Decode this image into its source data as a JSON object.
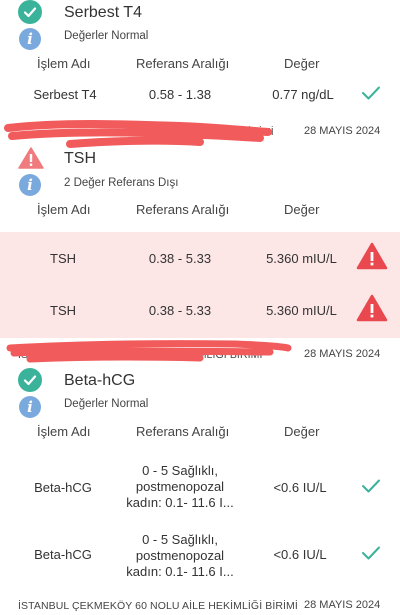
{
  "sections": [
    {
      "title": "Serbest T4",
      "status": "Değerler Normal",
      "headers": {
        "name": "İşlem Adı",
        "range": "Referans Aralığı",
        "value": "Değer"
      },
      "rows": [
        {
          "name": "Serbest T4",
          "range": "0.58 - 1.38",
          "value": "0.77 ng/dL",
          "flag": "check-icon"
        }
      ],
      "footer": "...HEKİMLİĞİ BİRİMİ",
      "date": "28 MAYIS 2024"
    },
    {
      "title": "TSH",
      "status": "2 Değer Referans Dışı",
      "headers": {
        "name": "İşlem Adı",
        "range": "Referans Aralığı",
        "value": "Değer"
      },
      "rows": [
        {
          "name": "TSH",
          "range": "0.38 - 5.33",
          "value": "5.360 mIU/L",
          "flag": "warning-icon"
        },
        {
          "name": "TSH",
          "range": "0.38 - 5.33",
          "value": "5.360 mIU/L",
          "flag": "warning-icon"
        }
      ],
      "footer": "İSTANBUL ÇEKMEKÖY ... AİLE HEKİMLİĞİ BİRİMİ",
      "date": "28 MAYIS 2024"
    },
    {
      "title": "Beta-hCG",
      "status": "Değerler Normal",
      "headers": {
        "name": "İşlem Adı",
        "range": "Referans Aralığı",
        "value": "Değer"
      },
      "rows": [
        {
          "name": "Beta-hCG",
          "range_lines": [
            "0 - 5 Sağlıklı,",
            "postmenopozal",
            "kadın: 0.1- 11.6 I..."
          ],
          "value": "<0.6 IU/L",
          "flag": "check-icon"
        },
        {
          "name": "Beta-hCG",
          "range_lines": [
            "0 - 5 Sağlıklı,",
            "postmenopozal",
            "kadın: 0.1- 11.6 I..."
          ],
          "value": "<0.6 IU/L",
          "flag": "check-icon"
        }
      ],
      "footer": "İSTANBUL ÇEKMEKÖY 60 NOLU AİLE HEKİMLİĞİ BİRİMİ",
      "date": "28 MAYIS 2024"
    }
  ],
  "colors": {
    "normal": "#3bb39a",
    "info": "#7aa9dd",
    "warning": "#e8484e",
    "redaction": "#f15b5b",
    "alert_row_bg": "#fde6e6"
  }
}
